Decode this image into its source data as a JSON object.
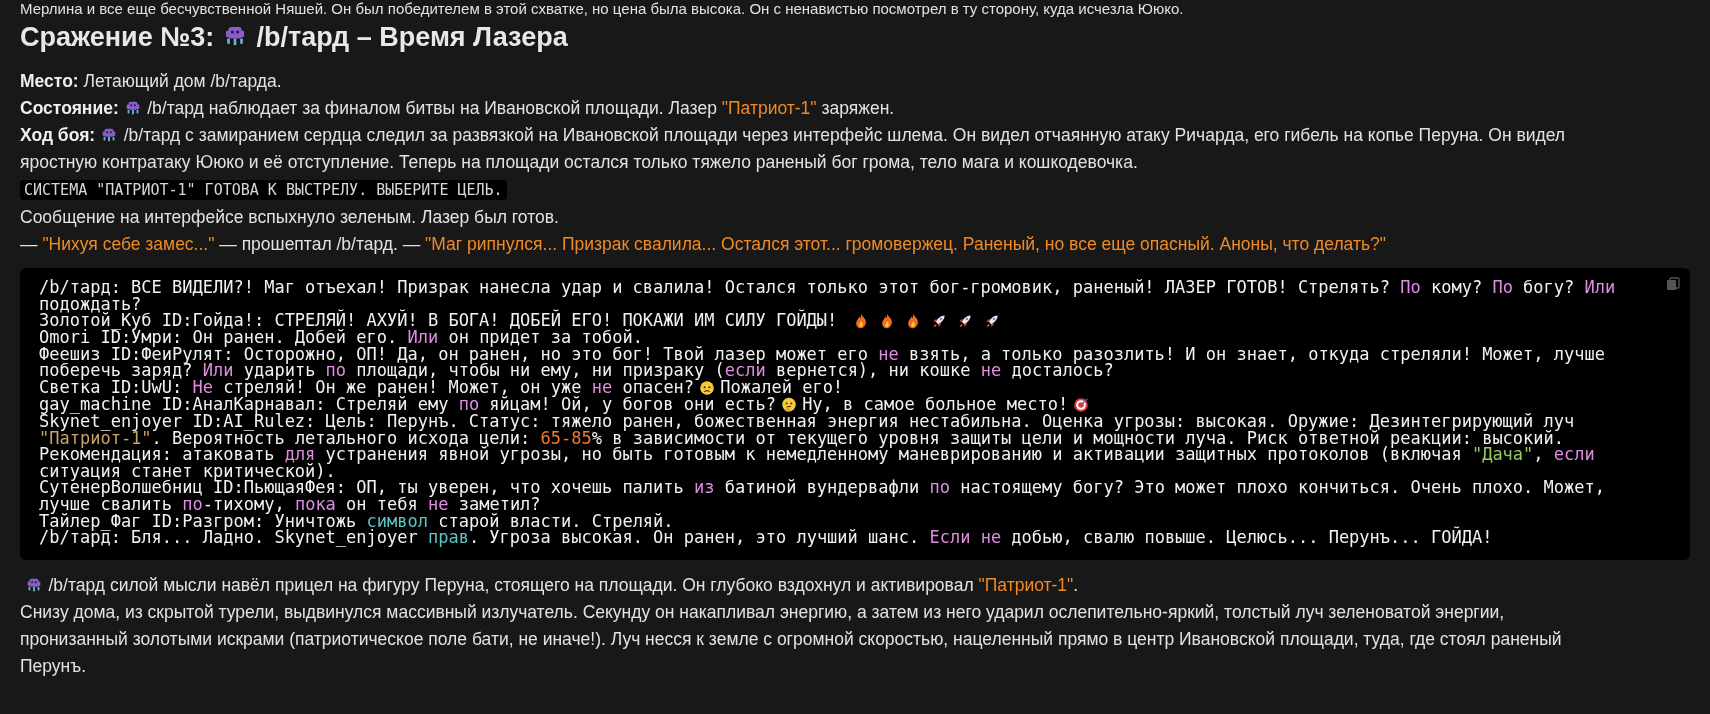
{
  "intro_fragment": "Мерлина и все еще бесчувственной Няшей. Он был победителем в этой схватке, но цена была высока. Он с ненавистью посмотрел в ту сторону, куда исчезла Ююко.",
  "heading": [
    {
      "kind": "text",
      "text": "Сражение №3:"
    },
    {
      "kind": "alien"
    },
    {
      "kind": "text",
      "text": "/b/тард – Время Лазера"
    }
  ],
  "paragraphs_before": [
    {
      "segments": [
        {
          "kind": "label",
          "text": "Место:"
        },
        {
          "kind": "text",
          "text": " Летающий дом /b/тарда."
        }
      ]
    },
    {
      "segments": [
        {
          "kind": "label",
          "text": "Состояние:"
        },
        {
          "kind": "alien"
        },
        {
          "kind": "text",
          "text": "/b/тард наблюдает за финалом битвы на Ивановской площади. Лазер "
        },
        {
          "kind": "quote",
          "text": "\"Патриот-1\""
        },
        {
          "kind": "text",
          "text": " заряжен."
        }
      ]
    },
    {
      "segments": [
        {
          "kind": "label",
          "text": "Ход боя:"
        },
        {
          "kind": "alien"
        },
        {
          "kind": "text",
          "text": "/b/тард с замиранием сердца следил за развязкой на Ивановской площади через интерфейс шлема. Он видел отчаянную атаку Ричарда, его гибель на копье Перуна. Он видел"
        }
      ]
    },
    {
      "segments": [
        {
          "kind": "text",
          "text": "яростную контратаку Ююко и её отступление. Теперь на площади остался только тяжело раненый бог грома, тело мага и кошкодевочка."
        }
      ]
    },
    {
      "segments": [
        {
          "kind": "code",
          "text": "СИСТЕМА \"ПАТРИОТ-1\" ГОТОВА К ВЫСТРЕЛУ. ВЫБЕРИТЕ ЦЕЛЬ."
        }
      ]
    },
    {
      "segments": [
        {
          "kind": "text",
          "text": "Сообщение на интерфейсе вспыхнуло зеленым. Лазер был готов."
        }
      ]
    },
    {
      "segments": [
        {
          "kind": "text",
          "text": "— "
        },
        {
          "kind": "quote",
          "text": "\"Нихуя себе замес...\""
        },
        {
          "kind": "text",
          "text": " — прошептал /b/тард. — "
        },
        {
          "kind": "quote",
          "text": "\"Маг рипнулся... Призрак свалила... Остался этот... громовержец. Раненый, но все еще опасный. Аноны, что делать?\""
        }
      ]
    }
  ],
  "code_block": {
    "lines": [
      {
        "segments": [
          {
            "kind": "plain",
            "text": "/b/тард: ВСЕ ВИДЕЛИ?! Маг отъехал! Призрак нанесла удар и свалила! Остался только этот бог-громовик, раненый! ЛАЗЕР ГОТОВ! Стрелять? "
          },
          {
            "kind": "keyword",
            "text": "По"
          },
          {
            "kind": "plain",
            "text": " кому? "
          },
          {
            "kind": "keyword",
            "text": "По"
          },
          {
            "kind": "plain",
            "text": " богу? "
          },
          {
            "kind": "keyword",
            "text": "Или"
          },
          {
            "kind": "plain",
            "text": " подождать?"
          }
        ]
      },
      {
        "segments": [
          {
            "kind": "plain",
            "text": "Золотой_Куб ID:Гойда!: СТРЕЛЯЙ! АХУЙ! В БОГА! ДОБЕЙ ЕГО! ПОКАЖИ ИМ СИЛУ ГОЙДЫ! "
          },
          {
            "kind": "fire"
          },
          {
            "kind": "fire"
          },
          {
            "kind": "fire"
          },
          {
            "kind": "rocket"
          },
          {
            "kind": "rocket"
          },
          {
            "kind": "rocket"
          }
        ]
      },
      {
        "segments": [
          {
            "kind": "plain",
            "text": "Omori ID:Умри: Он ранен. Добей его. "
          },
          {
            "kind": "keyword",
            "text": "Или"
          },
          {
            "kind": "plain",
            "text": " он придет за тобой."
          }
        ]
      },
      {
        "segments": [
          {
            "kind": "plain",
            "text": "Феешиз ID:ФеиРулят: Осторожно, ОП! Да, он ранен, но это бог! Твой лазер может его "
          },
          {
            "kind": "keyword",
            "text": "не"
          },
          {
            "kind": "plain",
            "text": " взять, а только разозлить! И он знает, откуда стреляли! Может, лучше поберечь заряд? "
          },
          {
            "kind": "keyword",
            "text": "Или"
          },
          {
            "kind": "plain",
            "text": " ударить "
          },
          {
            "kind": "keyword",
            "text": "по"
          },
          {
            "kind": "plain",
            "text": " площади, чтобы ни ему, ни призраку ("
          },
          {
            "kind": "keyword",
            "text": "если"
          },
          {
            "kind": "plain",
            "text": " вернется), ни кошке "
          },
          {
            "kind": "keyword",
            "text": "не"
          },
          {
            "kind": "plain",
            "text": " досталось?"
          }
        ]
      },
      {
        "segments": [
          {
            "kind": "plain",
            "text": "Светка ID:UwU: "
          },
          {
            "kind": "keyword",
            "text": "Не"
          },
          {
            "kind": "plain",
            "text": " стреляй! Он же ранен! Может, он уже "
          },
          {
            "kind": "keyword",
            "text": "не"
          },
          {
            "kind": "plain",
            "text": " опасен?"
          },
          {
            "kind": "sad"
          },
          {
            "kind": "plain",
            "text": "Пожалей его!"
          }
        ]
      },
      {
        "segments": [
          {
            "kind": "plain",
            "text": "gay_machine ID:АналКарнавал: Стреляй ему "
          },
          {
            "kind": "keyword",
            "text": "по"
          },
          {
            "kind": "plain",
            "text": " яйцам! Ой, у богов они есть?"
          },
          {
            "kind": "thinking"
          },
          {
            "kind": "plain",
            "text": "Ну, в самое больное место!"
          },
          {
            "kind": "target"
          }
        ]
      },
      {
        "segments": [
          {
            "kind": "plain",
            "text": "Skynet_enjoyer ID:AI_Rulez: Цель: Перунъ. Статус: тяжело ранен, божественная энергия нестабильна. Оценка угрозы: высокая. Оружие: Дезинтегрирующий луч "
          },
          {
            "kind": "literal",
            "text": "\"Патриот-1\""
          },
          {
            "kind": "plain",
            "text": ". Вероятность летального исхода цели: "
          },
          {
            "kind": "number",
            "text": "65-85"
          },
          {
            "kind": "plain",
            "text": "% в зависимости от текущего уровня защиты цели и мощности луча. Риск ответной реакции: высокий."
          }
        ]
      },
      {
        "segments": [
          {
            "kind": "plain",
            "text": "Рекомендация: атаковать "
          },
          {
            "kind": "keyword",
            "text": "для"
          },
          {
            "kind": "plain",
            "text": " устранения явной угрозы, но быть готовым к немедленному маневрированию и активации защитных протоколов (включая "
          },
          {
            "kind": "string",
            "text": "\"Дача\""
          },
          {
            "kind": "plain",
            "text": ", "
          },
          {
            "kind": "keyword",
            "text": "если"
          },
          {
            "kind": "plain",
            "text": " ситуация станет критической)."
          }
        ]
      },
      {
        "segments": [
          {
            "kind": "plain",
            "text": "СутенерВолшебниц ID:ПьющаяФея: ОП, ты уверен, что хочешь палить "
          },
          {
            "kind": "keyword",
            "text": "из"
          },
          {
            "kind": "plain",
            "text": " батиной вундервафли "
          },
          {
            "kind": "keyword",
            "text": "по"
          },
          {
            "kind": "plain",
            "text": " настоящему богу? Это может плохо кончиться. Очень плохо. Может, лучше свалить "
          },
          {
            "kind": "keyword",
            "text": "по"
          },
          {
            "kind": "plain",
            "text": "-тихому, "
          },
          {
            "kind": "keyword",
            "text": "пока"
          },
          {
            "kind": "plain",
            "text": " он тебя "
          },
          {
            "kind": "keyword",
            "text": "не"
          },
          {
            "kind": "plain",
            "text": " заметил?"
          }
        ]
      },
      {
        "segments": [
          {
            "kind": "plain",
            "text": "Тайлер_Фаг ID:Разгром: Уничтожь "
          },
          {
            "kind": "builtin",
            "text": "символ"
          },
          {
            "kind": "plain",
            "text": " старой власти. Стреляй."
          }
        ]
      },
      {
        "segments": [
          {
            "kind": "plain",
            "text": "/b/тард: Бля... Ладно. Skynet_enjoyer "
          },
          {
            "kind": "builtin",
            "text": "прав"
          },
          {
            "kind": "plain",
            "text": ". Угроза высокая. Он ранен, это лучший шанс. "
          },
          {
            "kind": "keyword",
            "text": "Если не"
          },
          {
            "kind": "plain",
            "text": " добью, свалю повыше. Целюсь... Перунъ... ГОЙДА!"
          }
        ]
      }
    ]
  },
  "paragraphs_after": [
    {
      "segments": [
        {
          "kind": "alien"
        },
        {
          "kind": "text",
          "text": "/b/тард силой мысли навёл прицел на фигуру Перуна, стоящего на площади. Он глубоко вздохнул и активировал "
        },
        {
          "kind": "quote",
          "text": "\"Патриот-1\""
        },
        {
          "kind": "text",
          "text": "."
        }
      ]
    },
    {
      "segments": [
        {
          "kind": "text",
          "text": "Снизу дома, из скрытой турели, выдвинулся массивный излучатель. Секунду он накапливал энергию, а затем из него ударил ослепительно-яркий, толстый луч зеленоватой энергии,"
        }
      ]
    },
    {
      "segments": [
        {
          "kind": "text",
          "text": "пронизанный золотыми искрами (патриотическое поле бати, не иначе!). Луч несся к земле с огромной скоростью, нацеленный прямо в центр Ивановской площади, туда, где стоял раненый"
        }
      ]
    },
    {
      "segments": [
        {
          "kind": "text",
          "text": "Перунъ."
        }
      ]
    }
  ]
}
